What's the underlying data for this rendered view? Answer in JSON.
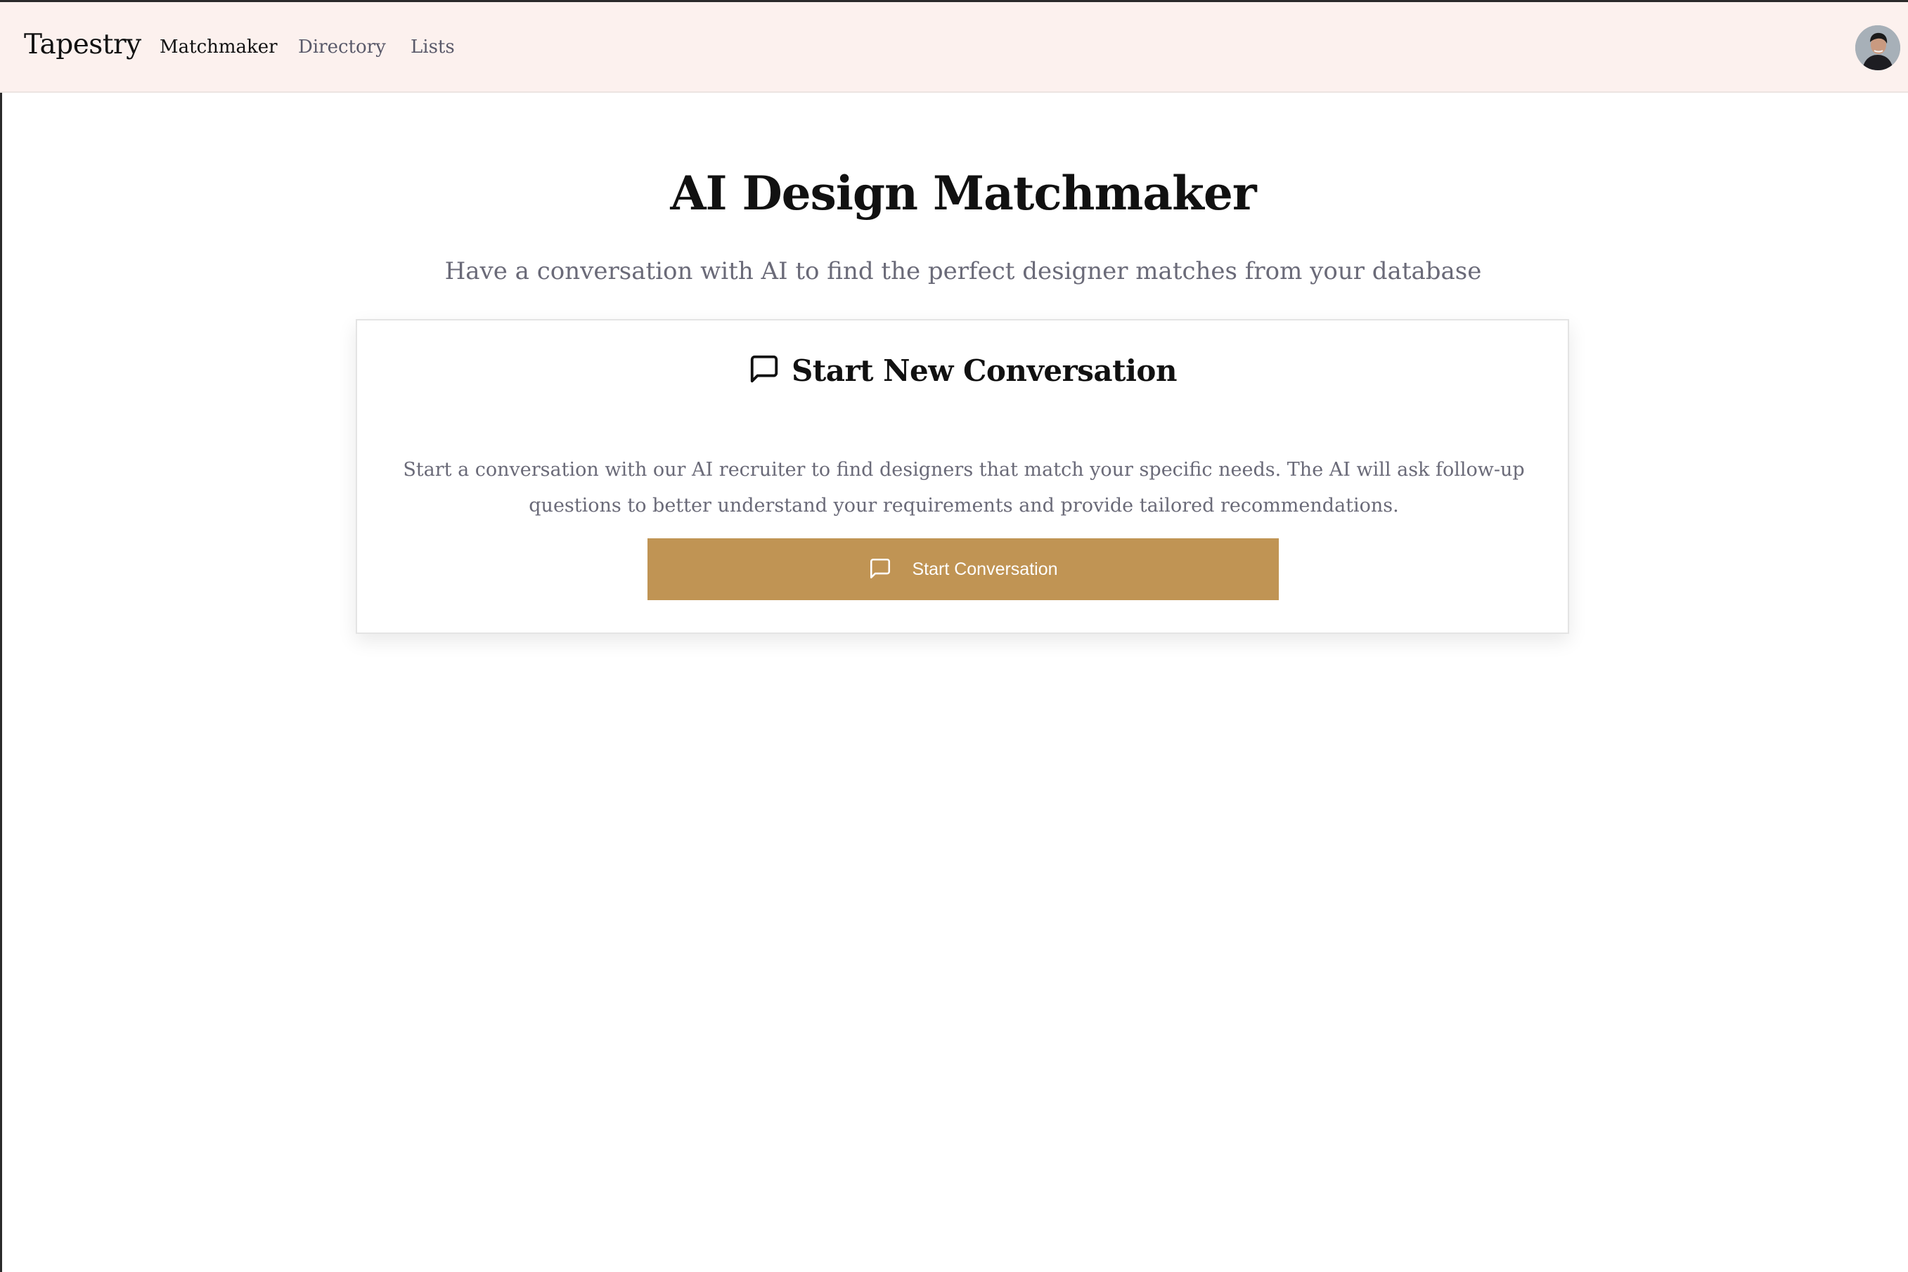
{
  "header": {
    "brand": "Tapestry",
    "nav": [
      {
        "label": "Matchmaker",
        "active": true
      },
      {
        "label": "Directory",
        "active": false
      },
      {
        "label": "Lists",
        "active": false
      }
    ],
    "avatar_icon": "user-avatar"
  },
  "main": {
    "title": "AI Design Matchmaker",
    "subtitle": "Have a conversation with AI to find the perfect designer matches from your database"
  },
  "card": {
    "icon": "message-square-icon",
    "title": "Start New Conversation",
    "description": "Start a conversation with our AI recruiter to find designers that match your specific needs. The AI will ask follow-up questions to better understand your requirements and provide tailored recommendations.",
    "button_label": "Start Conversation",
    "button_icon": "message-square-icon"
  },
  "colors": {
    "navbar_bg": "#fcf1ee",
    "accent": "#c09454",
    "muted_text": "#6a6a78"
  }
}
